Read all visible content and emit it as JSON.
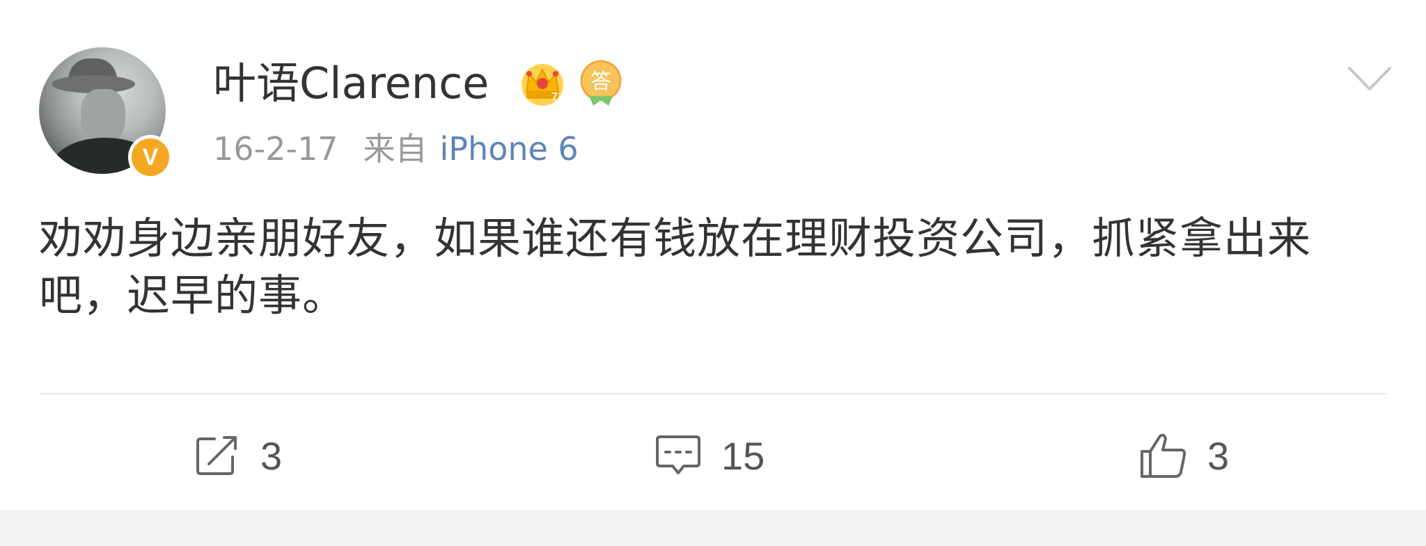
{
  "post": {
    "author": {
      "name": "叶语Clarence",
      "verified_badge": "V",
      "badges": [
        "crown-icon",
        "answer-icon"
      ],
      "answer_badge_text": "答"
    },
    "date": "16-2-17",
    "source_prefix": "来自",
    "source": "iPhone 6",
    "text": "劝劝身边亲朋好友，如果谁还有钱放在理财投资公司，抓紧拿出来吧，迟早的事。",
    "actions": {
      "repost_count": "3",
      "comment_count": "15",
      "like_count": "3"
    }
  },
  "colors": {
    "text": "#333333",
    "meta": "#999999",
    "link": "#5d84b7",
    "verified": "#f5a623",
    "background_gap": "#f2f2f2"
  }
}
